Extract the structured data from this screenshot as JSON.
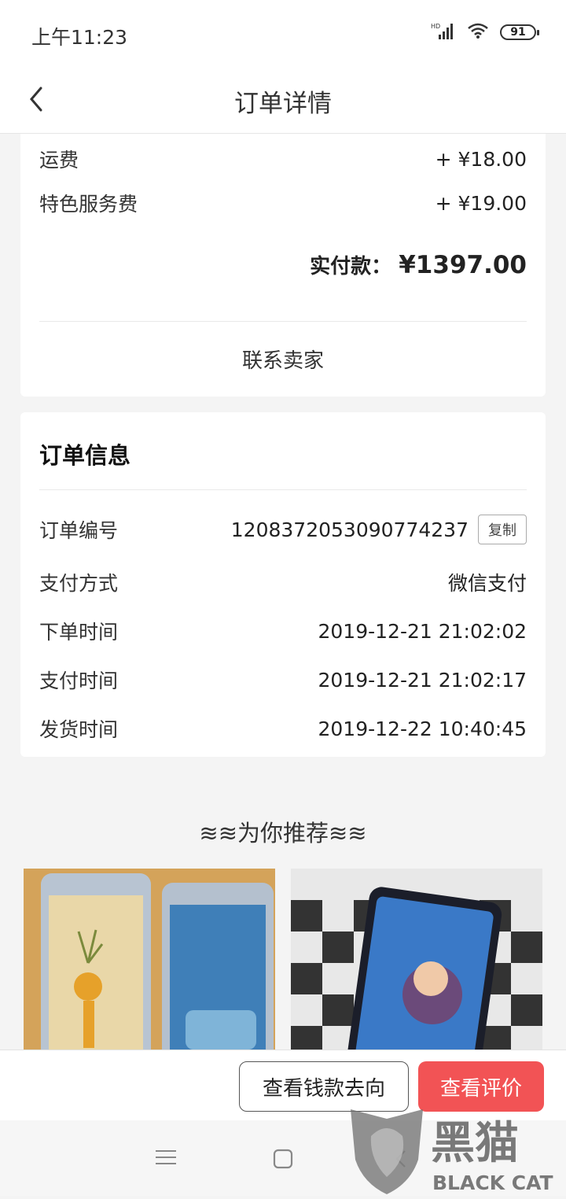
{
  "status_bar": {
    "time": "上午11:23",
    "battery": "91",
    "signal_label": "HD"
  },
  "nav": {
    "title": "订单详情"
  },
  "fees": [
    {
      "label": "运费",
      "value": "+ ¥18.00"
    },
    {
      "label": "特色服务费",
      "value": "+ ¥19.00"
    }
  ],
  "total": {
    "label": "实付款：",
    "value": "¥1397.00"
  },
  "contact_label": "联系卖家",
  "order_info": {
    "title": "订单信息",
    "order_no_label": "订单编号",
    "order_no": "1208372053090774237",
    "copy_label": "复制",
    "pay_method_label": "支付方式",
    "pay_method": "微信支付",
    "order_time_label": "下单时间",
    "order_time": "2019-12-21 21:02:02",
    "pay_time_label": "支付时间",
    "pay_time": "2019-12-21 21:02:17",
    "ship_time_label": "发货时间",
    "ship_time": "2019-12-22 10:40:45"
  },
  "recommend": {
    "title": "≋≋为你推荐≋≋"
  },
  "actions": {
    "money_flow": "查看钱款去向",
    "review": "查看评价"
  },
  "watermark": {
    "cn": "黑猫",
    "en": "BLACK CAT"
  },
  "colors": {
    "accent_red": "#f25355"
  }
}
